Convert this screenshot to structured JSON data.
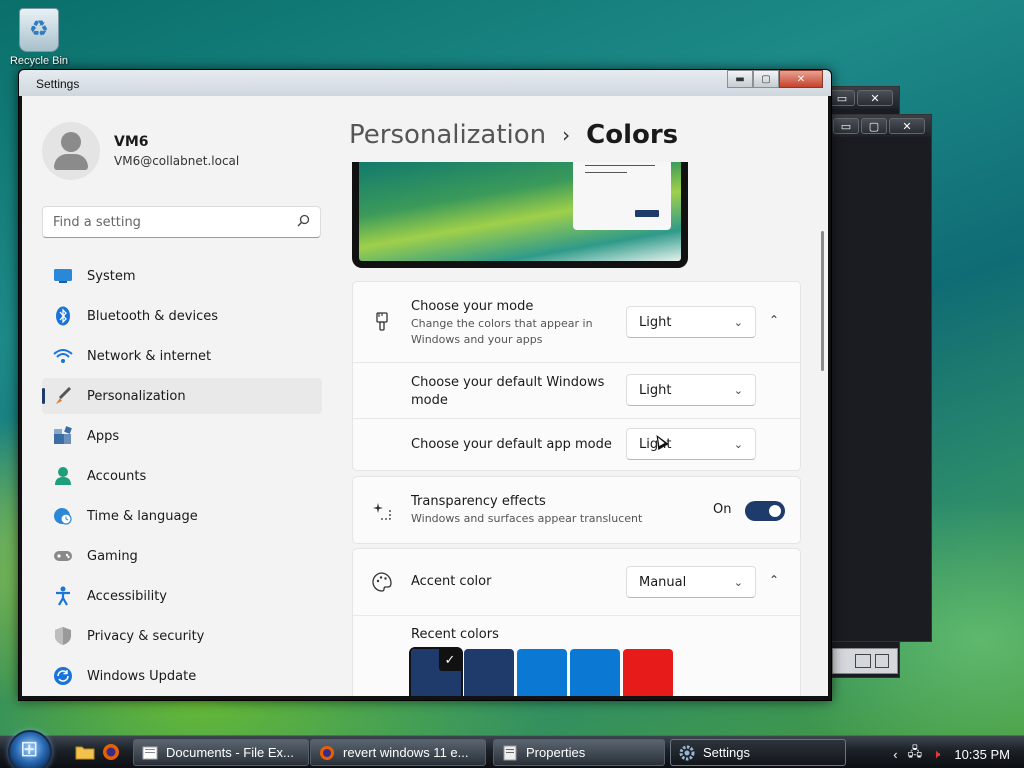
{
  "desktop": {
    "recycle_bin_label": "Recycle Bin"
  },
  "window": {
    "title": "Settings"
  },
  "profile": {
    "name": "VM6",
    "email": "VM6@collabnet.local"
  },
  "search": {
    "placeholder": "Find a setting"
  },
  "nav": [
    {
      "label": "System",
      "icon": "system-icon",
      "color": "#2b88d8"
    },
    {
      "label": "Bluetooth & devices",
      "icon": "bluetooth-icon",
      "color": "#1a73d9"
    },
    {
      "label": "Network & internet",
      "icon": "wifi-icon",
      "color": "#1a73d9"
    },
    {
      "label": "Personalization",
      "icon": "brush-icon",
      "color": "#e07a2e",
      "selected": true
    },
    {
      "label": "Apps",
      "icon": "apps-icon",
      "color": "#3a6ea5"
    },
    {
      "label": "Accounts",
      "icon": "accounts-icon",
      "color": "#1e9e7a"
    },
    {
      "label": "Time & language",
      "icon": "globe-clock-icon",
      "color": "#2b88d8"
    },
    {
      "label": "Gaming",
      "icon": "gamepad-icon",
      "color": "#7a7a7a"
    },
    {
      "label": "Accessibility",
      "icon": "accessibility-icon",
      "color": "#1a73d9"
    },
    {
      "label": "Privacy & security",
      "icon": "shield-icon",
      "color": "#8a8a8a"
    },
    {
      "label": "Windows Update",
      "icon": "update-icon",
      "color": "#1a73d9"
    }
  ],
  "breadcrumb": {
    "parent": "Personalization",
    "current": "Colors"
  },
  "mode": {
    "title": "Choose your mode",
    "subtitle": "Change the colors that appear in Windows and your apps",
    "value": "Light",
    "windows_mode_label": "Choose your default Windows mode",
    "windows_mode_value": "Light",
    "app_mode_label": "Choose your default app mode",
    "app_mode_value": "Light"
  },
  "transparency": {
    "title": "Transparency effects",
    "subtitle": "Windows and surfaces appear translucent",
    "state": "On"
  },
  "accent": {
    "title": "Accent color",
    "value": "Manual",
    "recent_label": "Recent colors",
    "recent_colors": [
      "#1f3b6b",
      "#1f3b6b",
      "#0b78d4",
      "#0b78d4",
      "#e81b1b"
    ]
  },
  "taskbar": {
    "buttons": [
      {
        "label": "Documents - File Ex...",
        "icon": "folder-icon"
      },
      {
        "label": "revert windows 11 e...",
        "icon": "firefox-icon"
      },
      {
        "label": "Properties",
        "icon": "properties-icon"
      },
      {
        "label": "Settings",
        "icon": "settings-gear-icon",
        "active": true
      }
    ],
    "clock": "10:35 PM"
  }
}
